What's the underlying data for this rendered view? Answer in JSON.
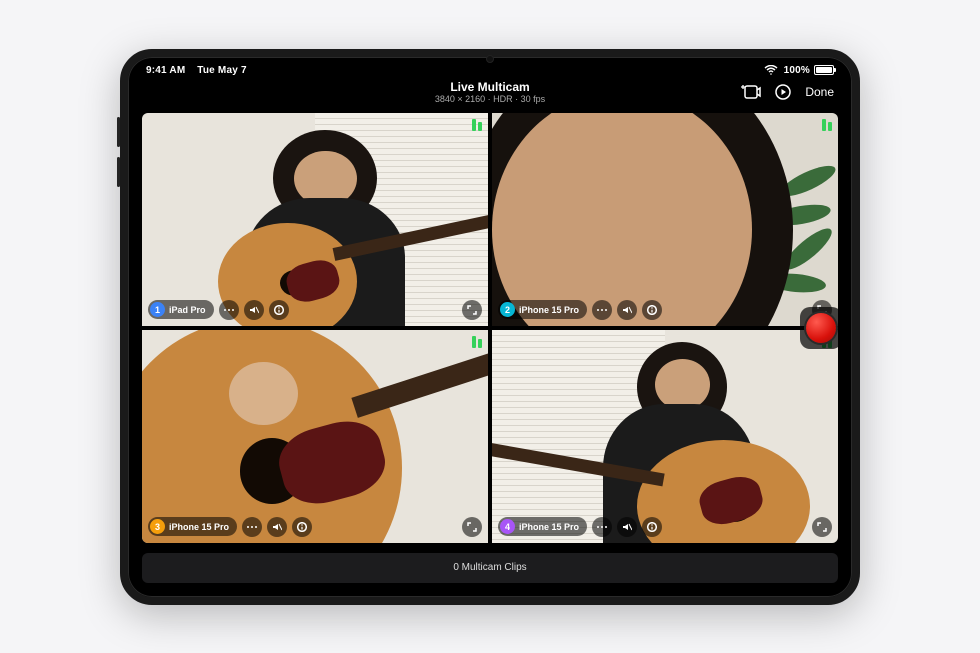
{
  "statusbar": {
    "time": "9:41 AM",
    "date": "Tue May 7",
    "battery_pct": "100%"
  },
  "header": {
    "title": "Live Multicam",
    "subtitle": "3840 × 2160 · HDR · 30 fps",
    "done_label": "Done"
  },
  "feeds": [
    {
      "number": "1",
      "device": "iPad Pro",
      "color_class": "c1"
    },
    {
      "number": "2",
      "device": "iPhone 15 Pro",
      "color_class": "c2"
    },
    {
      "number": "3",
      "device": "iPhone 15 Pro",
      "color_class": "c3"
    },
    {
      "number": "4",
      "device": "iPhone 15 Pro",
      "color_class": "c4"
    }
  ],
  "bottombar": {
    "clip_count_label": "0 Multicam Clips"
  }
}
